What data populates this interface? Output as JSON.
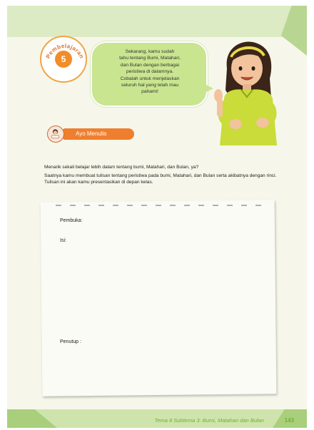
{
  "badge": {
    "arc_text": "Pembelajaran",
    "number": "5"
  },
  "speech": {
    "lines": [
      "Sekarang, kamu sudah",
      "tahu tentang Bumi, Matahari,",
      "dan Bulan dengan berbagai",
      "peristiwa di dalamnya.",
      "Cobalah untuk menjelaskan",
      "seluruh hal yang telah mau",
      "pahami!"
    ]
  },
  "section": {
    "label": "Ayo Menulis"
  },
  "paragraphs": {
    "p1": "Menarik sekali belajar lebih dalam tentang bumi, Matahari, dan Bulan, ya?",
    "p2": "Saatnya kamu membuat tulisan tentang peristiwa pada bumi, Matahari, dan Bulan serta akibatnya dengan rinci. Tulisan ini akan kamu presentasikan di depan kelas."
  },
  "form": {
    "pembuka": "Pembuka:",
    "isi": "Isi:",
    "penutup": "Penutup  :"
  },
  "footer": {
    "text": "Tema 8 Subtema 3: Bumi, Matahari dan Bulan",
    "page": "143"
  },
  "colors": {
    "accent_orange": "#ef7f2e",
    "bubble_green": "#c9e58f",
    "band_green": "#dcebc4",
    "footer_green": "#6fb02e"
  }
}
